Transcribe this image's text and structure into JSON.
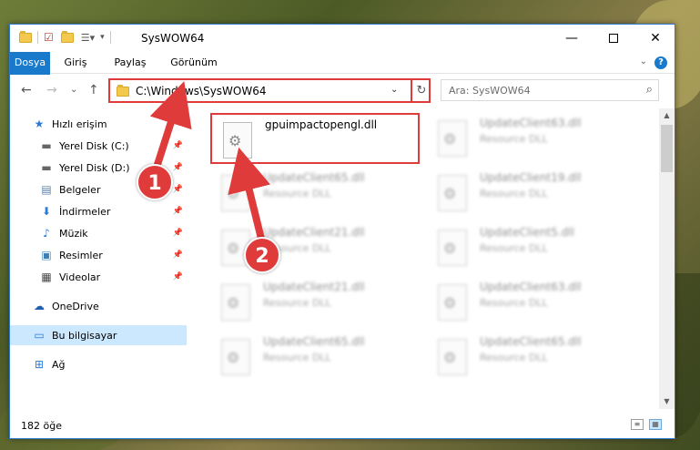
{
  "window": {
    "title": "SysWOW64"
  },
  "ribbon": {
    "tabs": [
      {
        "label": "Dosya"
      },
      {
        "label": "Giriş"
      },
      {
        "label": "Paylaş"
      },
      {
        "label": "Görünüm"
      }
    ],
    "help_label": "?"
  },
  "navigation": {
    "address_path": "C:\\Windows\\SysWOW64",
    "search_placeholder": "Ara: SysWOW64"
  },
  "sidebar": {
    "items": [
      {
        "label": "Hızlı erişim",
        "icon": "star-icon"
      },
      {
        "label": "Yerel Disk (C:)",
        "icon": "drive-icon"
      },
      {
        "label": "Yerel Disk (D:)",
        "icon": "drive-icon"
      },
      {
        "label": "Belgeler",
        "icon": "documents-icon"
      },
      {
        "label": "İndirmeler",
        "icon": "download-icon"
      },
      {
        "label": "Müzik",
        "icon": "music-icon"
      },
      {
        "label": "Resimler",
        "icon": "pictures-icon"
      },
      {
        "label": "Videolar",
        "icon": "video-icon"
      },
      {
        "label": "OneDrive",
        "icon": "cloud-icon"
      },
      {
        "label": "Bu bilgisayar",
        "icon": "computer-icon"
      },
      {
        "label": "Ağ",
        "icon": "network-icon"
      }
    ]
  },
  "files": [
    {
      "name": "gpuimpactopengl.dll",
      "type": ""
    },
    {
      "name": "UpdateClient63.dll",
      "type": "Resource DLL"
    },
    {
      "name": "UpdateClient65.dll",
      "type": "Resource DLL"
    },
    {
      "name": "UpdateClient19.dll",
      "type": "Resource DLL"
    },
    {
      "name": "UpdateClient21.dll",
      "type": "Resource DLL"
    },
    {
      "name": "UpdateClient5.dll",
      "type": "Resource DLL"
    },
    {
      "name": "UpdateClient21.dll",
      "type": "Resource DLL"
    },
    {
      "name": "UpdateClient63.dll",
      "type": "Resource DLL"
    },
    {
      "name": "UpdateClient65.dll",
      "type": "Resource DLL"
    },
    {
      "name": "UpdateClient65.dll",
      "type": "Resource DLL"
    }
  ],
  "status": {
    "item_count": "182 öğe"
  },
  "annotations": {
    "step1": "1",
    "step2": "2"
  },
  "colors": {
    "accent": "#1979ca",
    "highlight": "#e03b3b",
    "selection": "#cce8ff"
  }
}
